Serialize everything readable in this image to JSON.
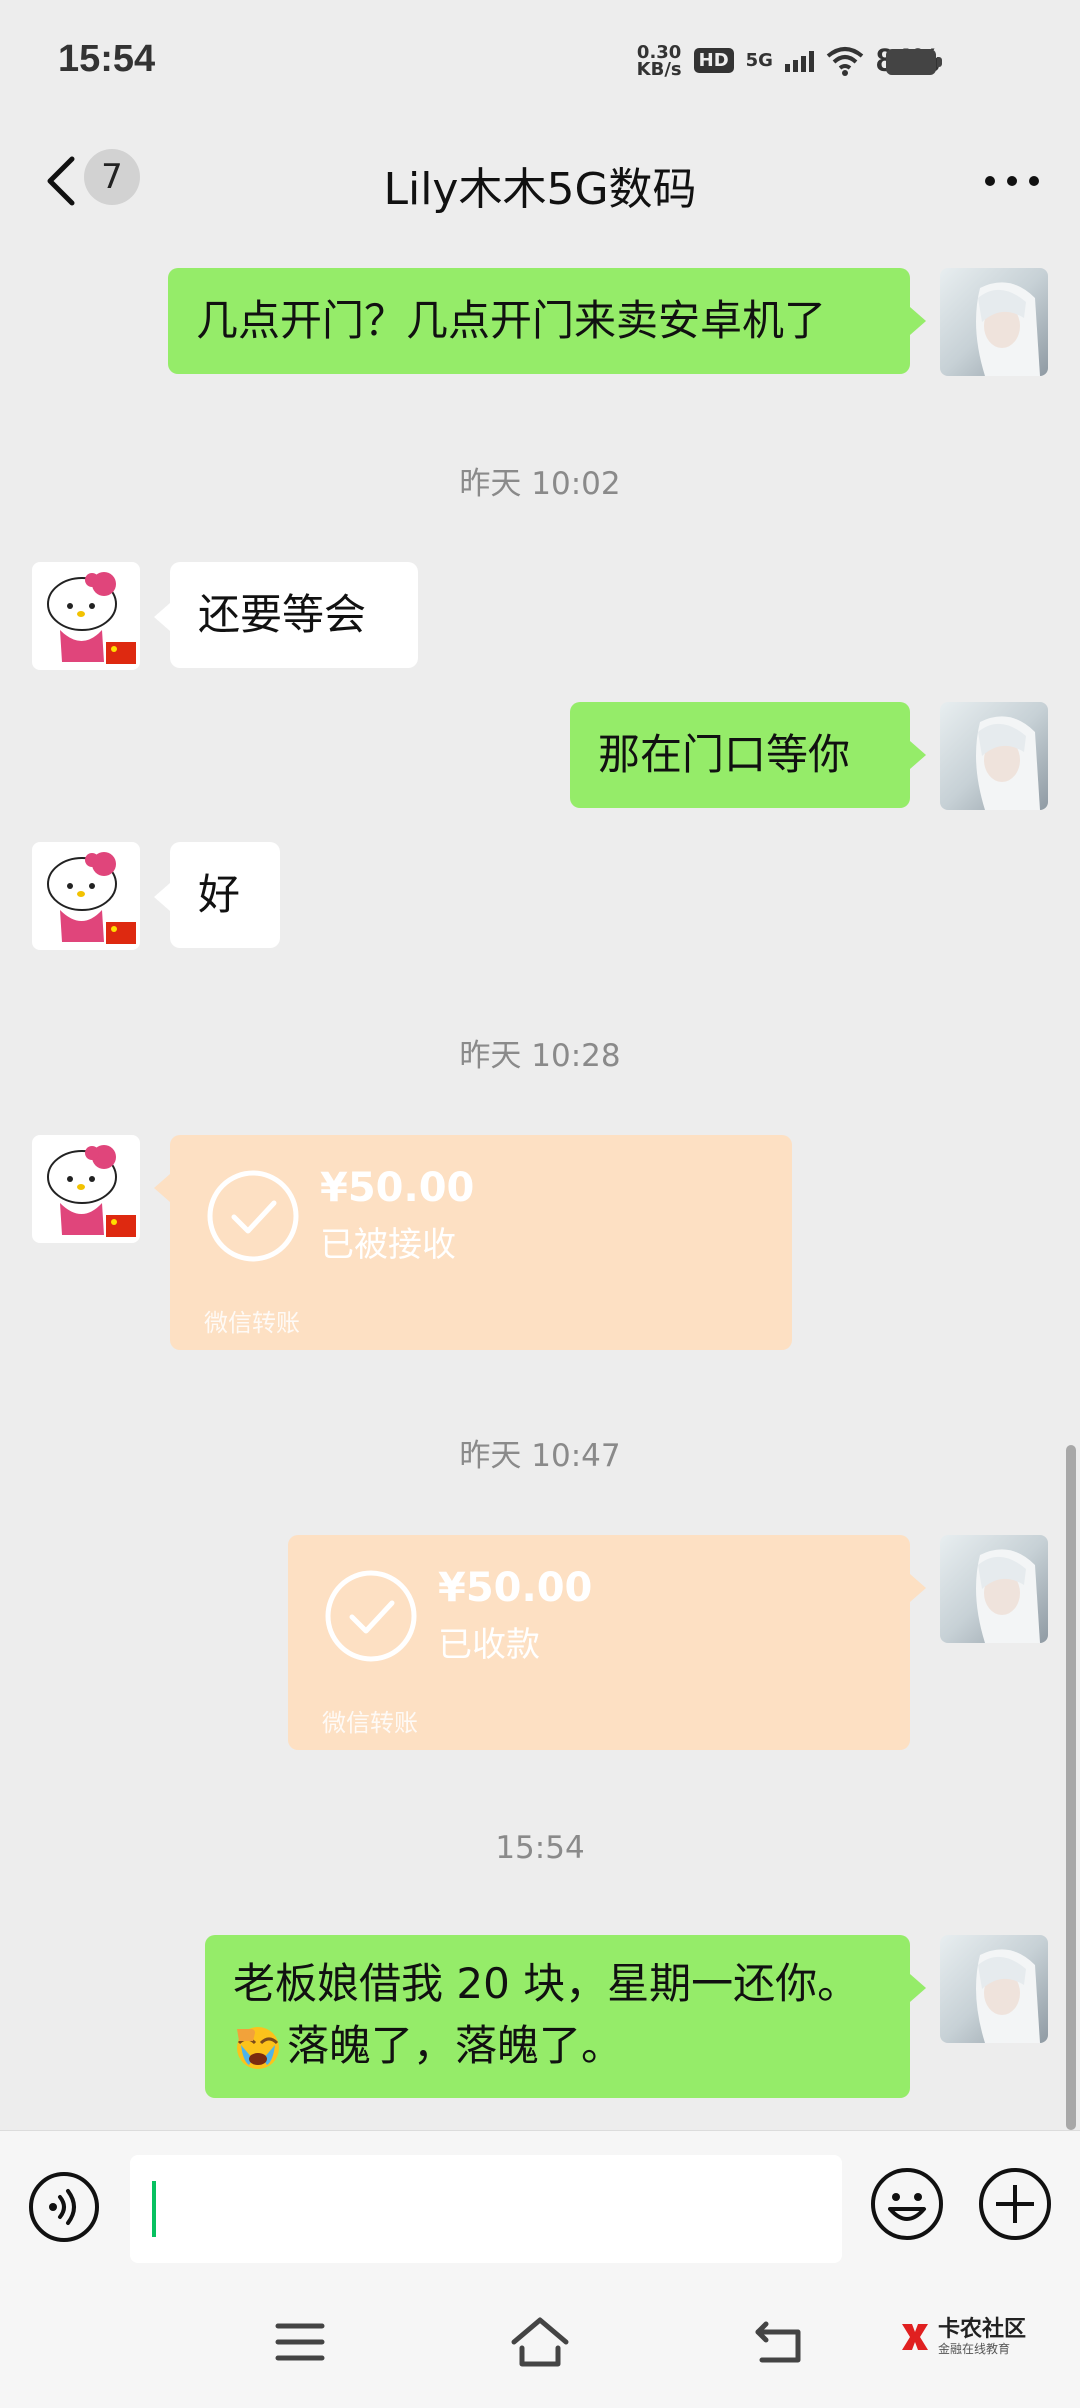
{
  "status_bar": {
    "time": "15:54",
    "net_speed_value": "0.30",
    "net_speed_unit": "KB/s",
    "hd_label": "HD",
    "network_label": "5G",
    "battery_pct": "84%"
  },
  "header": {
    "unread_count": "7",
    "title": "Lily木木5G数码"
  },
  "messages": [
    {
      "sender": "me",
      "text": "几点开门？几点开门来卖安卓机了"
    },
    {
      "type": "timestamp",
      "text": "昨天 10:02"
    },
    {
      "sender": "them",
      "text": "还要等会"
    },
    {
      "sender": "me",
      "text": "那在门口等你"
    },
    {
      "sender": "them",
      "text": "好"
    },
    {
      "type": "timestamp",
      "text": "昨天 10:28"
    },
    {
      "sender": "them",
      "type": "transfer",
      "amount": "¥50.00",
      "status": "已被接收",
      "footer": "微信转账"
    },
    {
      "type": "timestamp",
      "text": "昨天 10:47"
    },
    {
      "sender": "me",
      "type": "transfer",
      "amount": "¥50.00",
      "status": "已收款",
      "footer": "微信转账"
    },
    {
      "type": "timestamp",
      "text": "15:54"
    },
    {
      "sender": "me",
      "line1": "老板娘借我 20 块，星期一还你。",
      "line2": "落魄了，落魄了。",
      "emoji": "facepalm-cry"
    }
  ],
  "watermark": {
    "title": "卡农社区",
    "subtitle": "金融在线教育"
  },
  "colors": {
    "bg": "#ededed",
    "my_bubble": "#95ec69",
    "their_bubble": "#ffffff",
    "transfer": "#fde0c3",
    "accent": "#07c160"
  }
}
